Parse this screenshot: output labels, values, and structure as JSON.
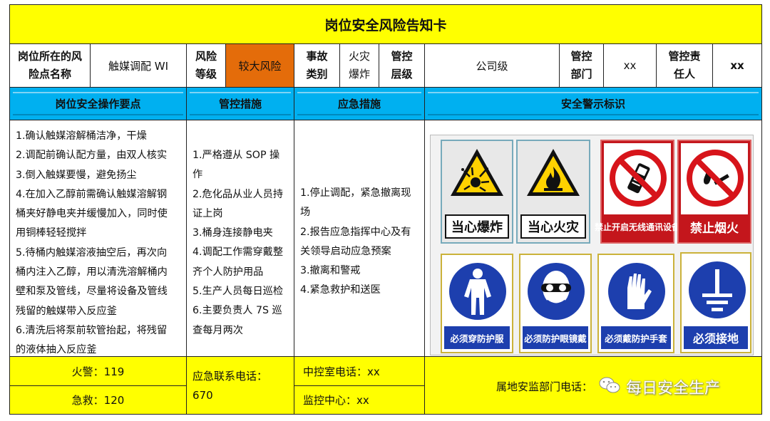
{
  "title": "岗位安全风险告知卡",
  "info": {
    "location_label": "岗位所在的风险点名称",
    "location_value": "触媒调配 WI",
    "risk_level_label": "风险等级",
    "risk_level_value": "较大风险",
    "accident_type_label": "事故类别",
    "accident_type_value": "火灾爆炸",
    "control_level_label": "管控层级",
    "control_level_value": "公司级",
    "control_dept_label": "管控部门",
    "control_dept_value": "xx",
    "responsible_label": "管控责任人",
    "responsible_value": "xx"
  },
  "sections": {
    "operations": "岗位安全操作要点",
    "controls": "管控措施",
    "emergency": "应急措施",
    "signs": "安全警示标识"
  },
  "operations_lines": [
    "1.确认触媒溶解桶洁净，干燥",
    "2.调配前确认配方量，由双人核实",
    "3.倒入触媒要慢，避免扬尘",
    "4.在加入乙醇前需确认触媒溶解钢",
    "桶夹好静电夹并缓慢加入，同时使",
    "用铜棒轻轻搅拌",
    "5.待桶内触媒溶液抽空后，再次向",
    "桶内注入乙醇，用以清洗溶解桶内",
    "壁和泵及管线，尽量将设备及管线",
    "残留的触媒带入反应釜",
    "6.清洗后将泵前软管抬起，将残留",
    "的液体抽入反应釜"
  ],
  "controls_lines": [
    "1.严格遵从 SOP 操",
    "作",
    "2.危化品从业人员持",
    "证上岗",
    "3.桶身连接静电夹",
    "4.调配工作需穿戴整",
    "齐个人防护用品",
    "5.生产人员每日巡检",
    "6.主要负责人 7S 巡",
    "查每月两次"
  ],
  "emergency_lines": [
    "1.停止调配，紧急撤离现",
    "场",
    "2.报告应急指挥中心及有",
    "关领导启动应急预案",
    "3.撤离和警戒",
    "4.紧急救护和送医"
  ],
  "signs": [
    {
      "label": "当心爆炸",
      "icon": "explosion-warning-icon",
      "kind": "warning"
    },
    {
      "label": "当心火灾",
      "icon": "fire-warning-icon",
      "kind": "warning"
    },
    {
      "label": "禁止开启无线通讯设备",
      "icon": "no-wireless-device-icon",
      "kind": "prohibition"
    },
    {
      "label": "禁止烟火",
      "icon": "no-fire-icon",
      "kind": "prohibition"
    },
    {
      "label": "必须穿防护服",
      "icon": "protective-suit-icon",
      "kind": "mandatory"
    },
    {
      "label": "必须防护眼镜戴",
      "icon": "goggles-icon",
      "kind": "mandatory"
    },
    {
      "label": "必须戴防护手套",
      "icon": "gloves-icon",
      "kind": "mandatory"
    },
    {
      "label": "必须接地",
      "icon": "grounding-icon",
      "kind": "mandatory"
    }
  ],
  "footer": {
    "fire": "火警：119",
    "ambulance": "急救：120",
    "emergency_phone_label": "应急联系电话：",
    "emergency_phone_value": "670",
    "control_room": "中控室电话：xx",
    "monitor_center": "监控中心：xx",
    "supervision_phone": "属地安监部门电话：",
    "watermark": "每日安全生产"
  },
  "colors": {
    "yellow": "#ffff00",
    "blue": "#00b0f0",
    "risk_orange": "#e46c0a",
    "prohibition_red": "#c4161c",
    "mandatory_blue": "#1d3fae"
  }
}
